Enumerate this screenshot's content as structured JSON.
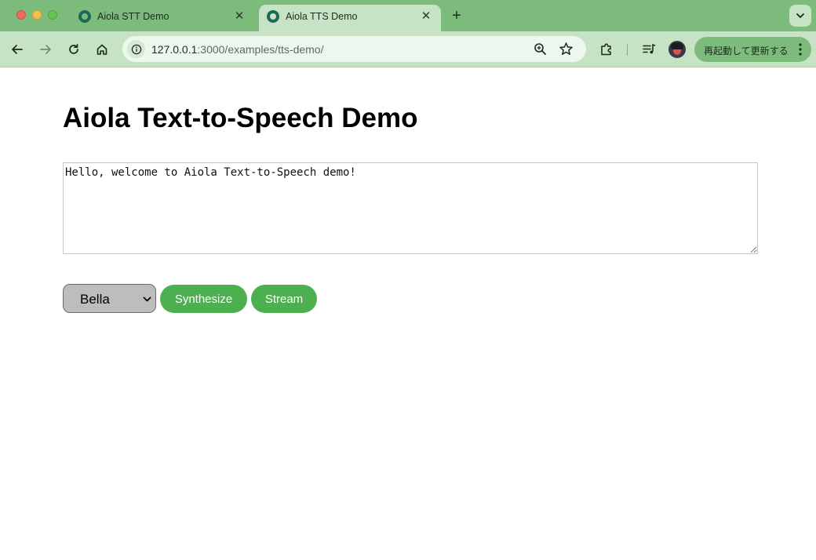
{
  "browser": {
    "tabs": [
      {
        "title": "Aiola STT Demo",
        "active": false
      },
      {
        "title": "Aiola TTS Demo",
        "active": true
      }
    ],
    "url_host": "127.0.0.1",
    "url_rest": ":3000/examples/tts-demo/",
    "update_button_label": "再起動して更新する",
    "colors": {
      "frame": "#7dbb7d",
      "toolbar": "#c6e3c6",
      "accent": "#4caf50"
    }
  },
  "page": {
    "title": "Aiola Text-to-Speech Demo",
    "textarea_value": "Hello, welcome to Aiola Text-to-Speech demo!",
    "voice_select": {
      "selected": "Bella"
    },
    "synthesize_label": "Synthesize",
    "stream_label": "Stream"
  },
  "icons": [
    "back-icon",
    "forward-icon",
    "reload-icon",
    "home-icon",
    "info-icon",
    "zoom-icon",
    "star-icon",
    "extensions-icon",
    "media-control-icon",
    "more-icon",
    "chevron-down-icon",
    "close-icon",
    "plus-icon"
  ]
}
